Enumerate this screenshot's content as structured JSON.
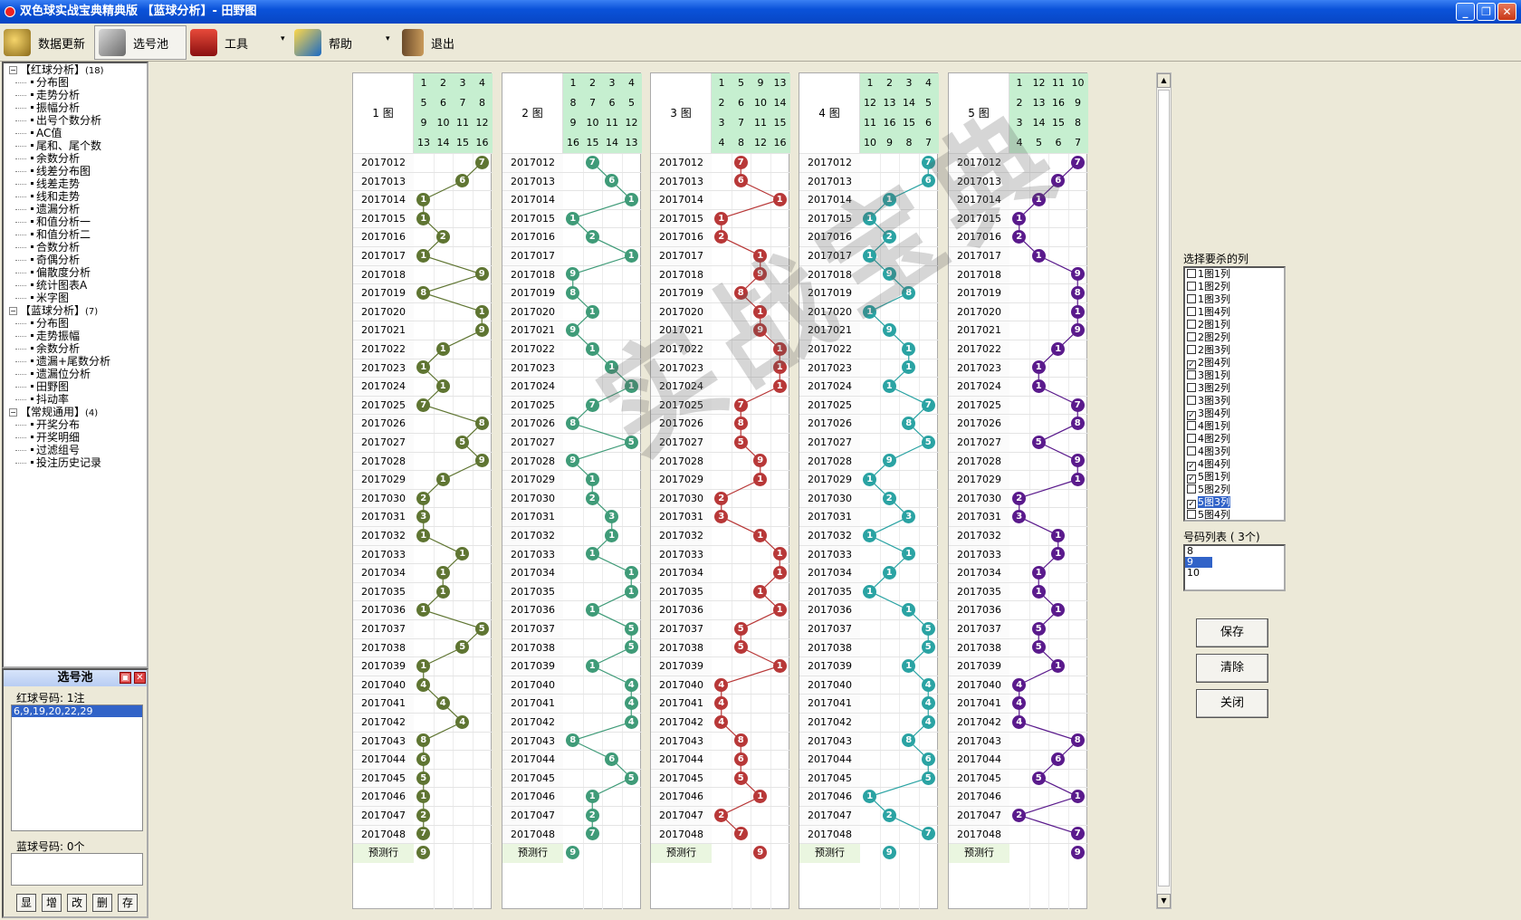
{
  "window": {
    "title": "双色球实战宝典精典版 【蓝球分析】- 田野图",
    "minimize": "_",
    "restore": "❐",
    "close": "✕"
  },
  "toolbar": {
    "items": [
      {
        "label": "数据更新",
        "icon": "database-update-icon"
      },
      {
        "label": "选号池",
        "icon": "number-pool-icon"
      },
      {
        "label": "工具",
        "icon": "toolbox-icon"
      },
      {
        "label": "帮助",
        "icon": "help-book-icon"
      },
      {
        "label": "退出",
        "icon": "exit-door-icon"
      }
    ],
    "dropdown": "▾"
  },
  "tree": {
    "groups": [
      {
        "label": "【红球分析】",
        "count": "(18)",
        "items": [
          "分布图",
          "走势分析",
          "振幅分析",
          "出号个数分析",
          "AC值",
          "尾和、尾个数",
          "余数分析",
          "线差分布图",
          "线差走势",
          "线和走势",
          "遗漏分析",
          "和值分析一",
          "和值分析二",
          "合数分析",
          "奇偶分析",
          "偏散度分析",
          "统计图表A",
          "米字图"
        ]
      },
      {
        "label": "【蓝球分析】",
        "count": "(7)",
        "items": [
          "分布图",
          "走势振幅",
          "余数分析",
          "遗漏+尾数分析",
          "遗漏位分析",
          "田野图",
          "抖动率"
        ]
      },
      {
        "label": "【常规通用】",
        "count": "(4)",
        "items": [
          "开奖分布",
          "开奖明细",
          "过滤组号",
          "投注历史记录"
        ]
      }
    ],
    "collapse": "−"
  },
  "pool": {
    "title": "选号池",
    "red_label": "红球号码:",
    "red_count": "1注",
    "red_selected": "6,9,19,20,22,29",
    "blue_label": "蓝球号码:",
    "blue_count": "0个",
    "buttons": [
      "显",
      "增",
      "改",
      "删",
      "存"
    ],
    "min_btn": "▣",
    "close_btn": "✕"
  },
  "periods": [
    "2017012",
    "2017013",
    "2017014",
    "2017015",
    "2017016",
    "2017017",
    "2017018",
    "2017019",
    "2017020",
    "2017021",
    "2017022",
    "2017023",
    "2017024",
    "2017025",
    "2017026",
    "2017027",
    "2017028",
    "2017029",
    "2017030",
    "2017031",
    "2017032",
    "2017033",
    "2017034",
    "2017035",
    "2017036",
    "2017037",
    "2017038",
    "2017039",
    "2017040",
    "2017041",
    "2017042",
    "2017043",
    "2017044",
    "2017045",
    "2017046",
    "2017047",
    "2017048"
  ],
  "predict_label": "预测行",
  "colors": {
    "panel1": "#5f7532",
    "panel2": "#3f9b78",
    "panel3": "#b83838",
    "panel4": "#2aa3a3",
    "panel5": "#5a1a8c",
    "header_cell": "#c6efd0",
    "selection": "#3163c8"
  },
  "panels": [
    {
      "label": "1 图",
      "grid": [
        [
          1,
          2,
          3,
          4
        ],
        [
          5,
          6,
          7,
          8
        ],
        [
          9,
          10,
          11,
          12
        ],
        [
          13,
          14,
          15,
          16
        ]
      ],
      "cols": [
        3,
        2,
        0,
        0,
        1,
        0,
        3,
        0,
        3,
        3,
        1,
        0,
        1,
        0,
        3,
        2,
        3,
        1,
        0,
        0,
        0,
        2,
        1,
        1,
        0,
        3,
        2,
        0,
        0,
        1,
        2,
        0,
        0,
        0,
        0,
        0,
        0
      ],
      "vals": [
        7,
        6,
        1,
        1,
        2,
        1,
        9,
        8,
        1,
        9,
        1,
        1,
        1,
        7,
        8,
        5,
        9,
        1,
        2,
        3,
        1,
        1,
        1,
        1,
        1,
        5,
        5,
        1,
        4,
        4,
        4,
        8,
        6,
        5,
        1,
        2,
        7
      ],
      "predict": {
        "col": 0,
        "val": 9
      }
    },
    {
      "label": "2 图",
      "grid": [
        [
          1,
          2,
          3,
          4
        ],
        [
          8,
          7,
          6,
          5
        ],
        [
          9,
          10,
          11,
          12
        ],
        [
          16,
          15,
          14,
          13
        ]
      ],
      "cols": [
        1,
        2,
        3,
        0,
        1,
        3,
        0,
        0,
        1,
        0,
        1,
        2,
        3,
        1,
        0,
        3,
        0,
        1,
        1,
        2,
        2,
        1,
        3,
        3,
        1,
        3,
        3,
        1,
        3,
        3,
        3,
        0,
        2,
        3,
        1,
        1,
        1
      ],
      "vals": [
        7,
        6,
        1,
        1,
        2,
        1,
        9,
        8,
        1,
        9,
        1,
        1,
        1,
        7,
        8,
        5,
        9,
        1,
        2,
        3,
        1,
        1,
        1,
        1,
        1,
        5,
        5,
        1,
        4,
        4,
        4,
        8,
        6,
        5,
        1,
        2,
        7
      ],
      "predict": {
        "col": 0,
        "val": 9
      }
    },
    {
      "label": "3 图",
      "grid": [
        [
          1,
          5,
          9,
          13
        ],
        [
          2,
          6,
          10,
          14
        ],
        [
          3,
          7,
          11,
          15
        ],
        [
          4,
          8,
          12,
          16
        ]
      ],
      "cols": [
        1,
        1,
        3,
        0,
        0,
        2,
        2,
        1,
        2,
        2,
        3,
        3,
        3,
        1,
        1,
        1,
        2,
        2,
        0,
        0,
        2,
        3,
        3,
        2,
        3,
        1,
        1,
        3,
        0,
        0,
        0,
        1,
        1,
        1,
        2,
        0,
        1
      ],
      "vals": [
        7,
        6,
        1,
        1,
        2,
        1,
        9,
        8,
        1,
        9,
        1,
        1,
        1,
        7,
        8,
        5,
        9,
        1,
        2,
        3,
        1,
        1,
        1,
        1,
        1,
        5,
        5,
        1,
        4,
        4,
        4,
        8,
        6,
        5,
        1,
        2,
        7
      ],
      "predict": {
        "col": 2,
        "val": 9
      }
    },
    {
      "label": "4 图",
      "grid": [
        [
          1,
          2,
          3,
          4
        ],
        [
          12,
          13,
          14,
          5
        ],
        [
          11,
          16,
          15,
          6
        ],
        [
          10,
          9,
          8,
          7
        ]
      ],
      "cols": [
        3,
        3,
        1,
        0,
        1,
        0,
        1,
        2,
        0,
        1,
        2,
        2,
        1,
        3,
        2,
        3,
        1,
        0,
        1,
        2,
        0,
        2,
        1,
        0,
        2,
        3,
        3,
        2,
        3,
        3,
        3,
        2,
        3,
        3,
        0,
        1,
        3
      ],
      "vals": [
        7,
        6,
        1,
        1,
        2,
        1,
        9,
        8,
        1,
        9,
        1,
        1,
        1,
        7,
        8,
        5,
        9,
        1,
        2,
        3,
        1,
        1,
        1,
        1,
        1,
        5,
        5,
        1,
        4,
        4,
        4,
        8,
        6,
        5,
        1,
        2,
        7
      ],
      "predict": {
        "col": 1,
        "val": 9
      }
    },
    {
      "label": "5 图",
      "grid": [
        [
          1,
          12,
          11,
          10
        ],
        [
          2,
          13,
          16,
          9
        ],
        [
          3,
          14,
          15,
          8
        ],
        [
          4,
          5,
          6,
          7
        ]
      ],
      "cols": [
        3,
        2,
        1,
        0,
        0,
        1,
        3,
        3,
        3,
        3,
        2,
        1,
        1,
        3,
        3,
        1,
        3,
        3,
        0,
        0,
        2,
        2,
        1,
        1,
        2,
        1,
        1,
        2,
        0,
        0,
        0,
        3,
        2,
        1,
        3,
        0,
        3
      ],
      "vals": [
        7,
        6,
        1,
        1,
        2,
        1,
        9,
        8,
        1,
        9,
        1,
        1,
        1,
        7,
        8,
        5,
        9,
        1,
        2,
        3,
        1,
        1,
        1,
        1,
        1,
        5,
        5,
        1,
        4,
        4,
        4,
        8,
        6,
        5,
        1,
        2,
        7
      ],
      "predict": {
        "col": 3,
        "val": 9
      }
    }
  ],
  "kill": {
    "title": "选择要杀的列",
    "items": [
      {
        "label": "1图1列",
        "checked": false
      },
      {
        "label": "1图2列",
        "checked": false
      },
      {
        "label": "1图3列",
        "checked": false
      },
      {
        "label": "1图4列",
        "checked": false
      },
      {
        "label": "2图1列",
        "checked": false
      },
      {
        "label": "2图2列",
        "checked": false
      },
      {
        "label": "2图3列",
        "checked": false
      },
      {
        "label": "2图4列",
        "checked": true
      },
      {
        "label": "3图1列",
        "checked": false
      },
      {
        "label": "3图2列",
        "checked": false
      },
      {
        "label": "3图3列",
        "checked": false
      },
      {
        "label": "3图4列",
        "checked": true
      },
      {
        "label": "4图1列",
        "checked": false
      },
      {
        "label": "4图2列",
        "checked": false
      },
      {
        "label": "4图3列",
        "checked": false
      },
      {
        "label": "4图4列",
        "checked": true
      },
      {
        "label": "5图1列",
        "checked": true
      },
      {
        "label": "5图2列",
        "checked": false
      },
      {
        "label": "5图3列",
        "checked": true,
        "selected": true
      },
      {
        "label": "5图4列",
        "checked": false
      }
    ]
  },
  "numlist": {
    "title": "号码列表 ( 3个)",
    "items": [
      "8",
      "9",
      "10"
    ],
    "selected": 1
  },
  "buttons": {
    "save": "保存",
    "clear": "清除",
    "close": "关闭"
  },
  "watermark": "实战宝典",
  "scroll": {
    "up": "▲",
    "down": "▼"
  }
}
